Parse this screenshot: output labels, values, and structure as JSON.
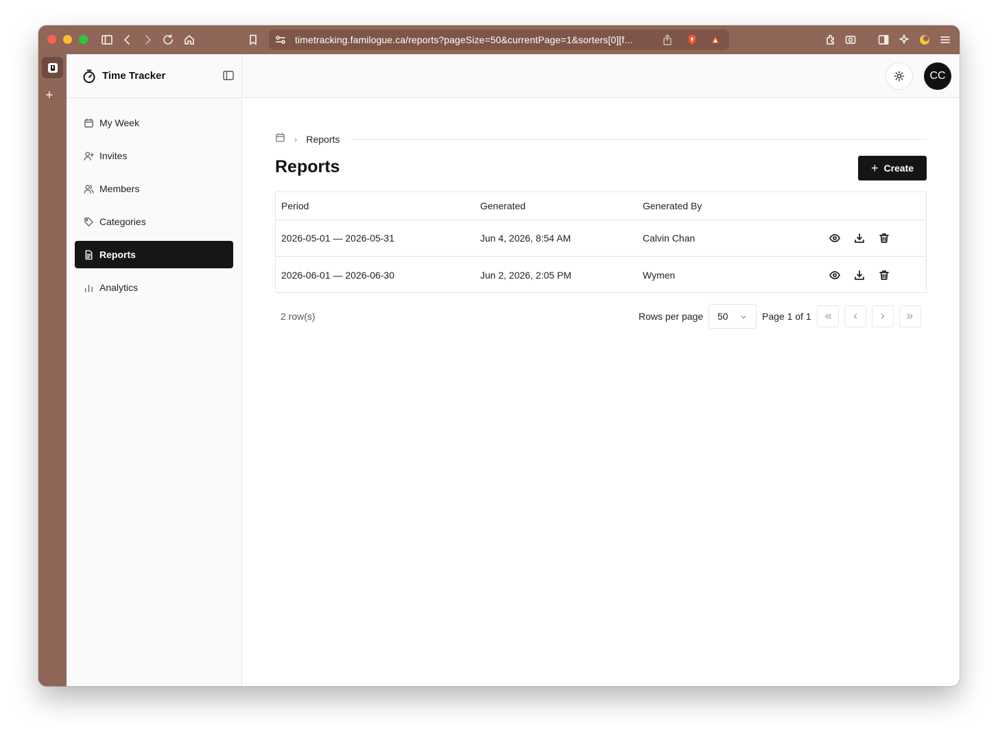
{
  "browser": {
    "url": "timetracking.familogue.ca/reports?pageSize=50&currentPage=1&sorters[0][f..."
  },
  "app": {
    "title": "Time Tracker",
    "user_initials": "CC"
  },
  "sidebar": {
    "items": [
      {
        "label": "My Week",
        "icon": "calendar-icon",
        "active": false
      },
      {
        "label": "Invites",
        "icon": "user-plus-icon",
        "active": false
      },
      {
        "label": "Members",
        "icon": "users-icon",
        "active": false
      },
      {
        "label": "Categories",
        "icon": "tag-icon",
        "active": false
      },
      {
        "label": "Reports",
        "icon": "document-icon",
        "active": true
      },
      {
        "label": "Analytics",
        "icon": "bar-chart-icon",
        "active": false
      }
    ]
  },
  "breadcrumb": {
    "current": "Reports"
  },
  "page": {
    "title": "Reports",
    "create_label": "Create"
  },
  "table": {
    "columns": [
      "Period",
      "Generated",
      "Generated By"
    ],
    "rows": [
      {
        "period": "2026-05-01 — 2026-05-31",
        "generated": "Jun 4, 2026, 8:54 AM",
        "generated_by": "Calvin Chan"
      },
      {
        "period": "2026-06-01 — 2026-06-30",
        "generated": "Jun 2, 2026, 2:05 PM",
        "generated_by": "Wymen"
      }
    ]
  },
  "pagination": {
    "row_count": "2 row(s)",
    "rows_per_page_label": "Rows per page",
    "rows_per_page_value": "50",
    "page_info": "Page 1 of 1"
  }
}
